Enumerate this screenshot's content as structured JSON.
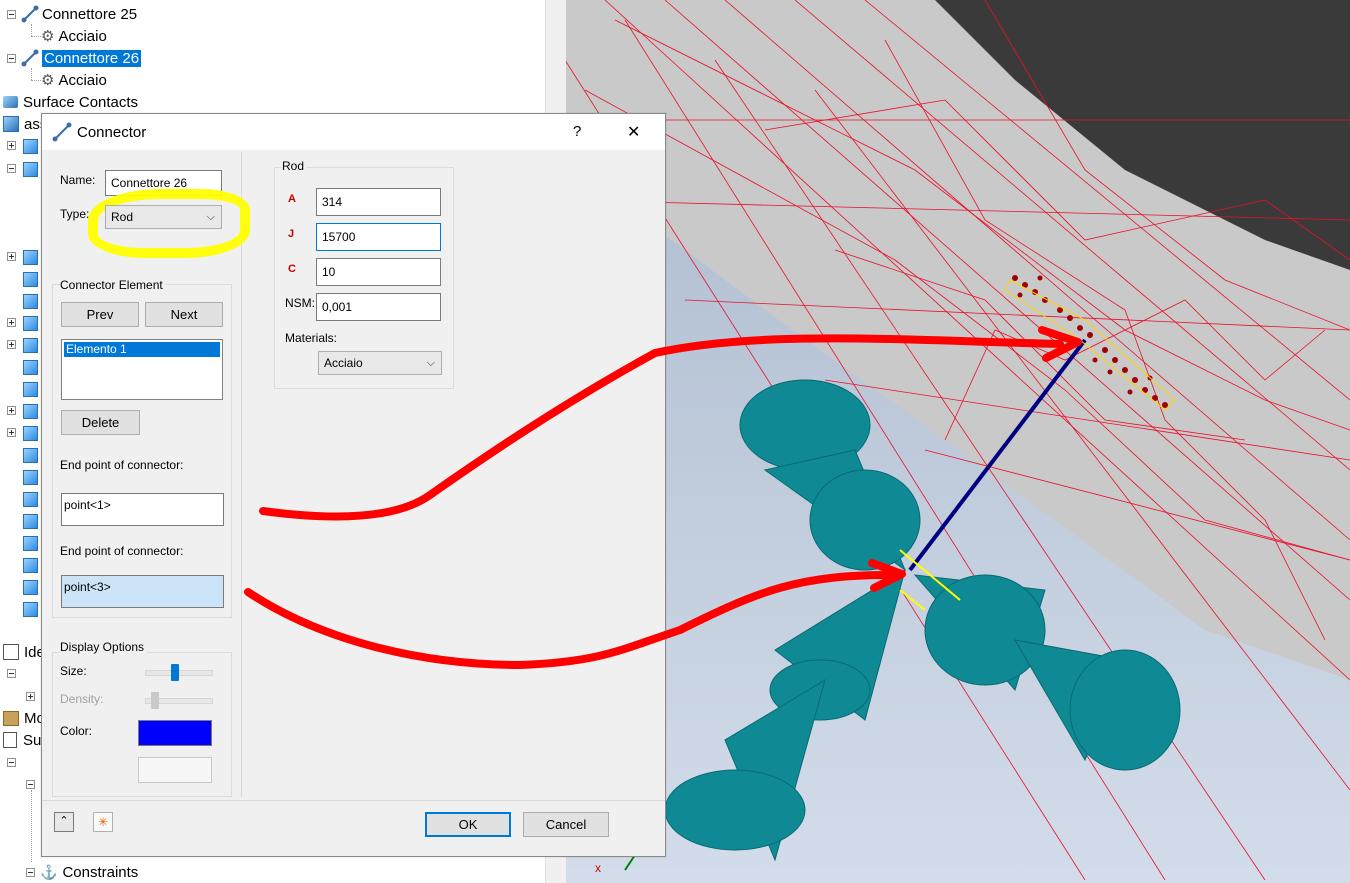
{
  "tree": {
    "items": [
      {
        "label": "Connettore 25",
        "icon": "connector-icon"
      },
      {
        "label": "Acciaio",
        "icon": "material-icon"
      },
      {
        "label": "Connettore 26",
        "icon": "connector-icon",
        "selected": true
      },
      {
        "label": "Acciaio",
        "icon": "material-icon"
      },
      {
        "label": "Surface Contacts",
        "icon": "surface-contacts-icon"
      },
      {
        "label": "ass",
        "icon": "assembly-icon"
      },
      {
        "label": "Ide",
        "icon": "idealization-icon"
      },
      {
        "label": "Mo",
        "icon": "model-icon"
      },
      {
        "label": "Su",
        "icon": "subcase-icon"
      },
      {
        "label": "Constraints",
        "icon": "constraints-icon"
      }
    ]
  },
  "dialog": {
    "title": "Connector",
    "help": "?",
    "close": "✕",
    "name_label": "Name:",
    "name_value": "Connettore 26",
    "type_label": "Type:",
    "type_value": "Rod",
    "connector_element": {
      "title": "Connector Element",
      "prev": "Prev",
      "next": "Next",
      "elements": [
        "Elemento 1"
      ],
      "delete": "Delete",
      "endpoint1_label": "End point of connector:",
      "endpoint1_value": "point<1>",
      "endpoint2_label": "End point of connector:",
      "endpoint2_value": "point<3>"
    },
    "display": {
      "title": "Display Options",
      "size_label": "Size:",
      "size_level": 0.45,
      "density_label": "Density:",
      "density_level": 0.1,
      "color_label": "Color:",
      "color": "#0000ff"
    },
    "rod": {
      "title": "Rod",
      "a_label": "A",
      "a_value": "314",
      "j_label": "J",
      "j_value": "15700",
      "c_label": "C",
      "c_value": "10",
      "nsm_label": "NSM:",
      "nsm_value": "0,001",
      "materials_label": "Materials:",
      "materials_value": "Acciaio"
    },
    "ok": "OK",
    "cancel": "Cancel"
  },
  "colors": {
    "selection": "#0078d7",
    "mesh_lines": "#e8102a",
    "annotation_red": "#ff0000",
    "highlight_yellow": "#ffff00",
    "cone_teal": "#0f8a94",
    "rod_line": "#000080"
  }
}
